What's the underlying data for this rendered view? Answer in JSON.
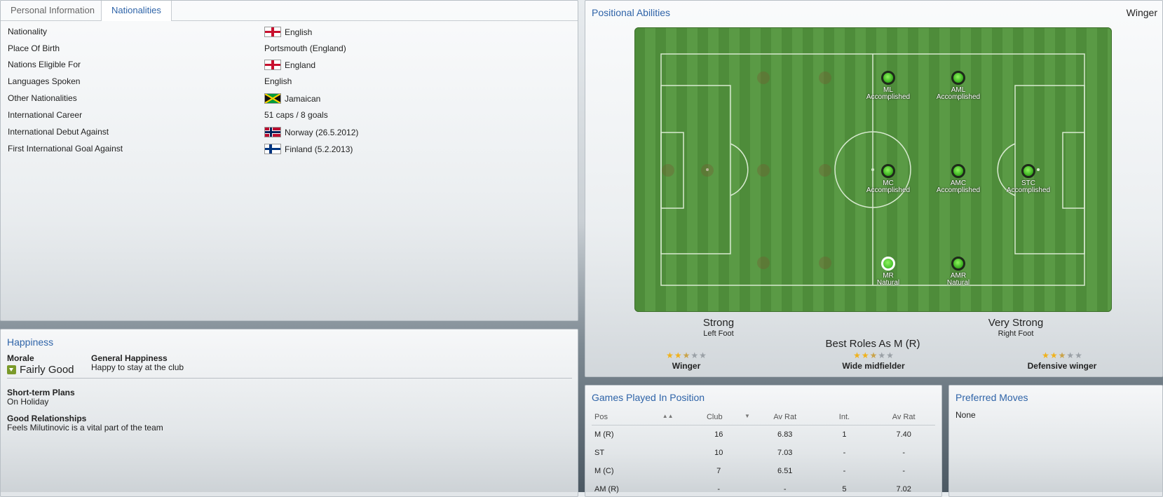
{
  "tabs": [
    {
      "label": "Personal Information",
      "active": false
    },
    {
      "label": "Nationalities",
      "active": true
    }
  ],
  "nationalities": [
    {
      "label": "Nationality",
      "value": "English",
      "flag": "england"
    },
    {
      "label": "Place Of Birth",
      "value": "Portsmouth (England)",
      "flag": ""
    },
    {
      "label": "Nations Eligible For",
      "value": "England",
      "flag": "england"
    },
    {
      "label": "Languages Spoken",
      "value": "English",
      "flag": ""
    },
    {
      "label": "Other Nationalities",
      "value": "Jamaican",
      "flag": "jamaica"
    },
    {
      "label": "International Career",
      "value": "51 caps / 8 goals",
      "flag": ""
    },
    {
      "label": "International Debut Against",
      "value": "Norway (26.5.2012)",
      "flag": "norway"
    },
    {
      "label": "First International Goal Against",
      "value": "Finland (5.2.2013)",
      "flag": "finland"
    }
  ],
  "happiness": {
    "title": "Happiness",
    "morale_label": "Morale",
    "morale_value": "Fairly Good",
    "morale_icon": "arrow-down-icon",
    "general_label": "General Happiness",
    "general_value": "Happy to stay at the club",
    "plans_label": "Short-term Plans",
    "plans_value": "On Holiday",
    "relationships_label": "Good Relationships",
    "relationships_value": "Feels Milutinovic is a vital part of the team"
  },
  "positional": {
    "title": "Positional Abilities",
    "role": "Winger",
    "positions": [
      {
        "code": "ML",
        "rating": "Accomplished",
        "natural": false
      },
      {
        "code": "AML",
        "rating": "Accomplished",
        "natural": false
      },
      {
        "code": "MC",
        "rating": "Accomplished",
        "natural": false
      },
      {
        "code": "AMC",
        "rating": "Accomplished",
        "natural": false
      },
      {
        "code": "STC",
        "rating": "Accomplished",
        "natural": false
      },
      {
        "code": "MR",
        "rating": "Natural",
        "natural": true
      },
      {
        "code": "AMR",
        "rating": "Natural",
        "natural": true
      }
    ],
    "left_foot": {
      "strength": "Strong",
      "label": "Left Foot"
    },
    "right_foot": {
      "strength": "Very Strong",
      "label": "Right Foot"
    },
    "best_roles_title": "Best Roles As M (R)",
    "roles": [
      {
        "name": "Winger",
        "stars": 2.5
      },
      {
        "name": "Wide midfielder",
        "stars": 2.5
      },
      {
        "name": "Defensive winger",
        "stars": 2.5
      }
    ],
    "colors": {
      "pitch": "#4e8c3a",
      "marker": "#45c12a"
    }
  },
  "games": {
    "title": "Games Played In Position",
    "headers": [
      "Pos",
      "Club",
      "Av Rat",
      "Int.",
      "Av Rat"
    ],
    "rows": [
      [
        "M (R)",
        "16",
        "6.83",
        "1",
        "7.40"
      ],
      [
        "ST",
        "10",
        "7.03",
        "-",
        "-"
      ],
      [
        "M (C)",
        "7",
        "6.51",
        "-",
        "-"
      ],
      [
        "AM (R)",
        "-",
        "-",
        "5",
        "7.02"
      ]
    ]
  },
  "moves": {
    "title": "Preferred Moves",
    "value": "None"
  }
}
